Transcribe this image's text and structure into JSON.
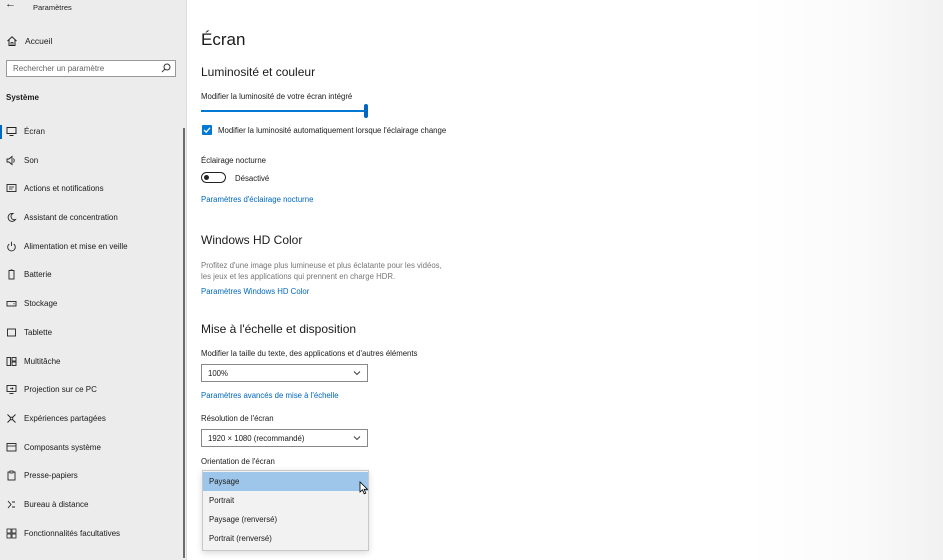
{
  "window": {
    "app_title": "Paramètres"
  },
  "sidebar": {
    "home_label": "Accueil",
    "search_placeholder": "Rechercher un paramètre",
    "section": "Système",
    "items": [
      {
        "label": "Écran",
        "icon": "monitor-icon",
        "selected": true
      },
      {
        "label": "Son",
        "icon": "speaker-icon"
      },
      {
        "label": "Actions et notifications",
        "icon": "notification-icon"
      },
      {
        "label": "Assistant de concentration",
        "icon": "moon-icon"
      },
      {
        "label": "Alimentation et mise en veille",
        "icon": "power-icon"
      },
      {
        "label": "Batterie",
        "icon": "battery-icon"
      },
      {
        "label": "Stockage",
        "icon": "storage-icon"
      },
      {
        "label": "Tablette",
        "icon": "tablet-icon"
      },
      {
        "label": "Multitâche",
        "icon": "multitask-icon"
      },
      {
        "label": "Projection sur ce PC",
        "icon": "projection-icon"
      },
      {
        "label": "Expériences partagées",
        "icon": "shared-icon"
      },
      {
        "label": "Composants système",
        "icon": "components-icon"
      },
      {
        "label": "Presse-papiers",
        "icon": "clipboard-icon"
      },
      {
        "label": "Bureau à distance",
        "icon": "remote-desktop-icon"
      },
      {
        "label": "Fonctionnalités facultatives",
        "icon": "features-icon"
      }
    ]
  },
  "main": {
    "title": "Écran",
    "brightness": {
      "heading": "Luminosité et couleur",
      "slider_label": "Modifier la luminosité de votre écran intégré",
      "slider_value": 1.0,
      "auto_label": "Modifier la luminosité automatiquement lorsque l'éclairage change",
      "auto_checked": true
    },
    "night_light": {
      "label": "Éclairage nocturne",
      "state": "Désactivé",
      "settings_link": "Paramètres d'éclairage nocturne"
    },
    "hdr": {
      "heading": "Windows HD Color",
      "description_line1": "Profitez d'une image plus lumineuse et plus éclatante pour les vidéos,",
      "description_line2": "les jeux et les applications qui prennent en charge HDR.",
      "link": "Paramètres Windows HD Color"
    },
    "scale": {
      "heading": "Mise à l'échelle et disposition",
      "size_label": "Modifier la taille du texte, des applications et d'autres éléments",
      "size_value": "100%",
      "advanced_link": "Paramètres avancés de mise à l'échelle",
      "resolution_label": "Résolution de l'écran",
      "resolution_value": "1920 × 1080 (recommandé)",
      "orientation_label": "Orientation de l'écran",
      "orientation_options": [
        "Paysage",
        "Portrait",
        "Paysage (renversé)",
        "Portrait (renversé)"
      ],
      "orientation_selected": "Paysage"
    }
  },
  "colors": {
    "accent": "#0067c0",
    "highlight": "#9ec6ea"
  }
}
